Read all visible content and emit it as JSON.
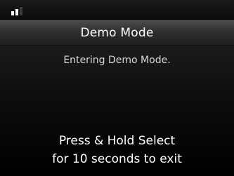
{
  "status_bar": {
    "signal_icon": "signal-strength-icon"
  },
  "header": {
    "title": "Demo Mode"
  },
  "main": {
    "message": "Entering Demo Mode.",
    "instruction_line1": "Press & Hold Select",
    "instruction_line2": "for 10 seconds to exit"
  }
}
